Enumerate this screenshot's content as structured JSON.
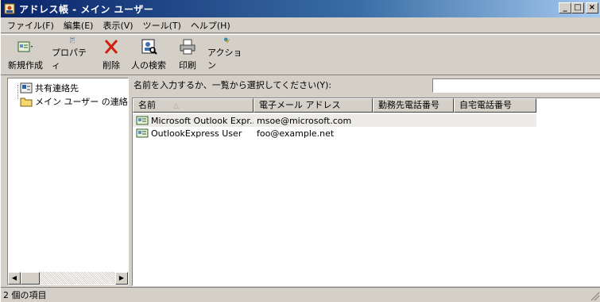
{
  "window": {
    "title": "アドレス帳 - メイン ユーザー"
  },
  "menu": [
    "ファイル(F)",
    "編集(E)",
    "表示(V)",
    "ツール(T)",
    "ヘルプ(H)"
  ],
  "toolbar": {
    "new": "新規作成",
    "properties": "プロパティ",
    "delete": "削除",
    "find": "人の検索",
    "print": "印刷",
    "action": "アクション"
  },
  "tree": {
    "shared": "共有連絡先",
    "main_user": "メイン ユーザー の連絡先"
  },
  "search": {
    "label": "名前を入力するか、一覧から選択してください(Y):",
    "value": ""
  },
  "list": {
    "columns": [
      "名前",
      "電子メール アドレス",
      "勤務先電話番号",
      "自宅電話番号"
    ],
    "rows": [
      {
        "name": "Microsoft Outlook Expr...",
        "email": "msoe@microsoft.com",
        "work": "",
        "home": ""
      },
      {
        "name": "OutlookExpress User",
        "email": "foo@example.net",
        "work": "",
        "home": ""
      }
    ]
  },
  "status": {
    "text": "2 個の項目"
  },
  "colors": {
    "titlebar": "#0a246a",
    "selection": "#d4d0c8",
    "chrome": "#d4d0c8"
  }
}
